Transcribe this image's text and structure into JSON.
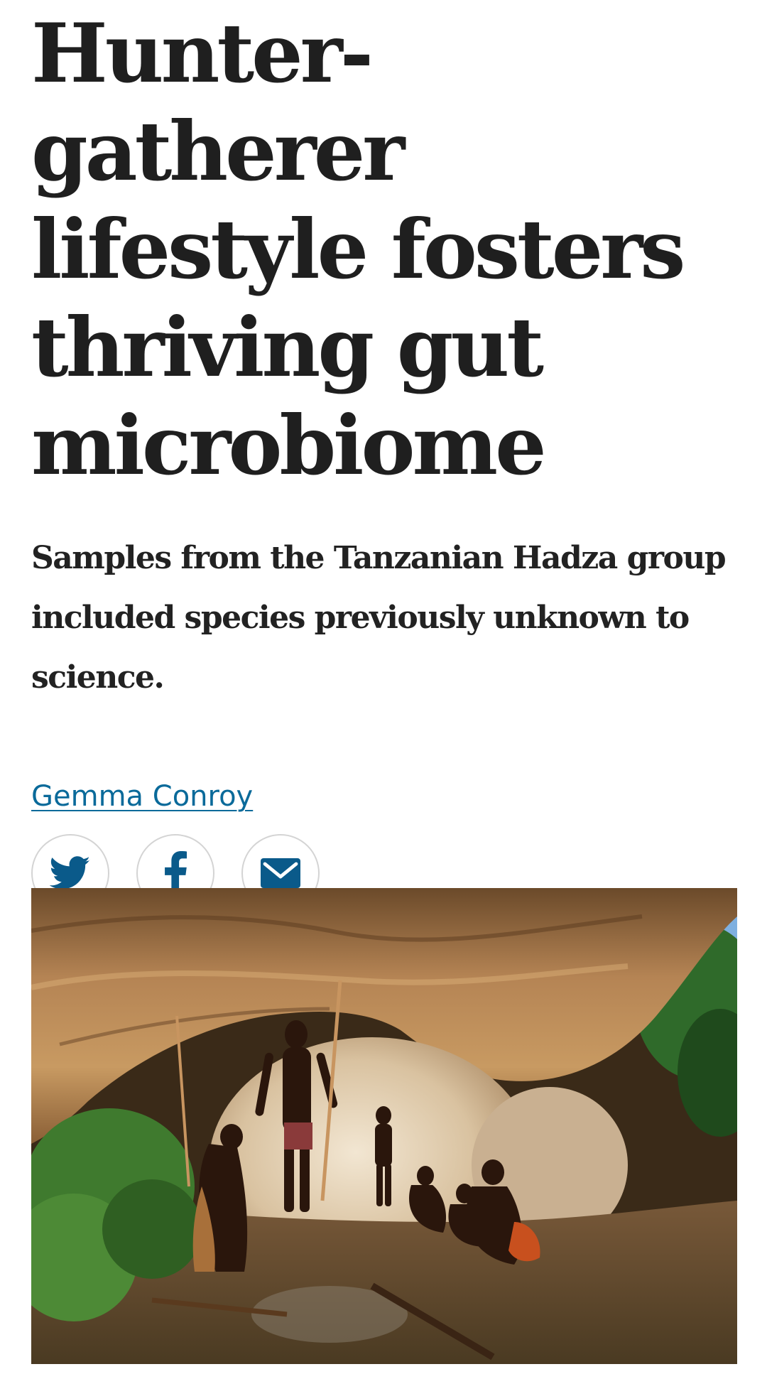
{
  "article": {
    "headline": "Hunter-gatherer lifestyle fosters thriving gut microbiome",
    "standfirst": "Samples from the Tanzanian Hadza group included species previously unknown to science.",
    "author": "Gemma Conroy"
  },
  "share": {
    "buttons": [
      {
        "icon": "twitter-icon"
      },
      {
        "icon": "facebook-icon"
      },
      {
        "icon": "email-icon"
      }
    ]
  },
  "colors": {
    "link": "#0a6a9a",
    "icon": "#0a5a8a",
    "text": "#222222"
  }
}
